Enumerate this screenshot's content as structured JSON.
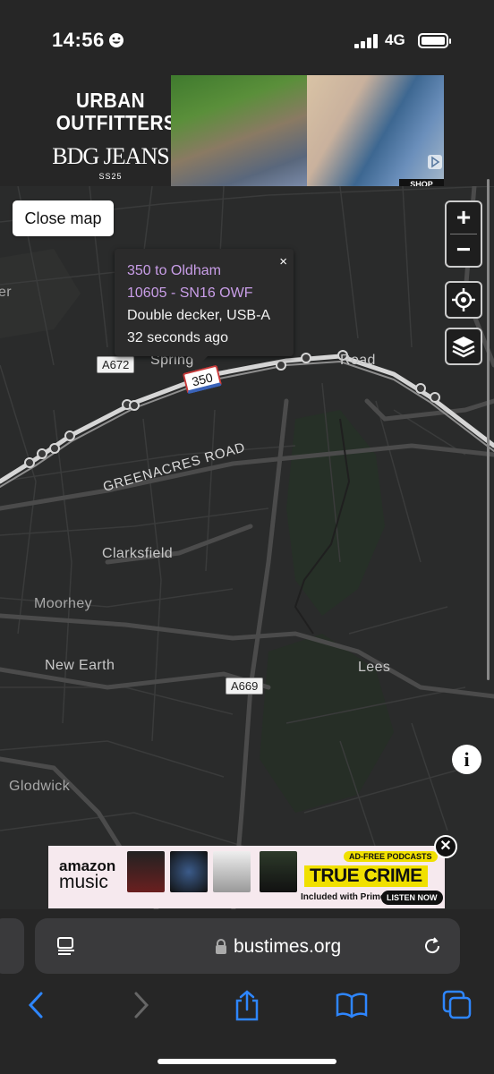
{
  "status": {
    "time": "14:56",
    "network": "4G"
  },
  "ads": {
    "top": {
      "brand_line1": "URBAN",
      "brand_line2": "OUTFITTERS",
      "brand_line3": "BDG JEANS",
      "brand_line4": "SS25",
      "cta": "SHOP"
    },
    "bottom": {
      "brand_line1": "amazon",
      "brand_line2": "music",
      "tag": "AD-FREE PODCASTS",
      "headline": "TRUE CRIME",
      "sub": "Included with Prime",
      "cta": "LISTEN NOW",
      "close": "✕"
    }
  },
  "map": {
    "close_label": "Close map",
    "zoom_in": "+",
    "zoom_out": "−",
    "info": "i",
    "popup": {
      "route": "350 to Oldham",
      "vehicle": "10605 - SN16 OWF",
      "type": "Double decker, USB-A",
      "updated": "32 seconds ago",
      "close": "×"
    },
    "bus_marker": "350",
    "labels": {
      "spring": "Spring",
      "road": "Road",
      "greenacres": "GREENACRES ROAD",
      "clarksfield": "Clarksfield",
      "moorhey": "Moorhey",
      "new_earth": "New Earth",
      "lees": "Lees",
      "glodwick": "Glodwick",
      "er": "er",
      "a672": "A672",
      "a669": "A669"
    }
  },
  "browser": {
    "url": "bustimes.org"
  },
  "colors": {
    "link": "#c99ee8",
    "map_bg": "#2a2b2b",
    "bus_red": "#c83a3a",
    "bus_blue": "#3a63b8"
  }
}
